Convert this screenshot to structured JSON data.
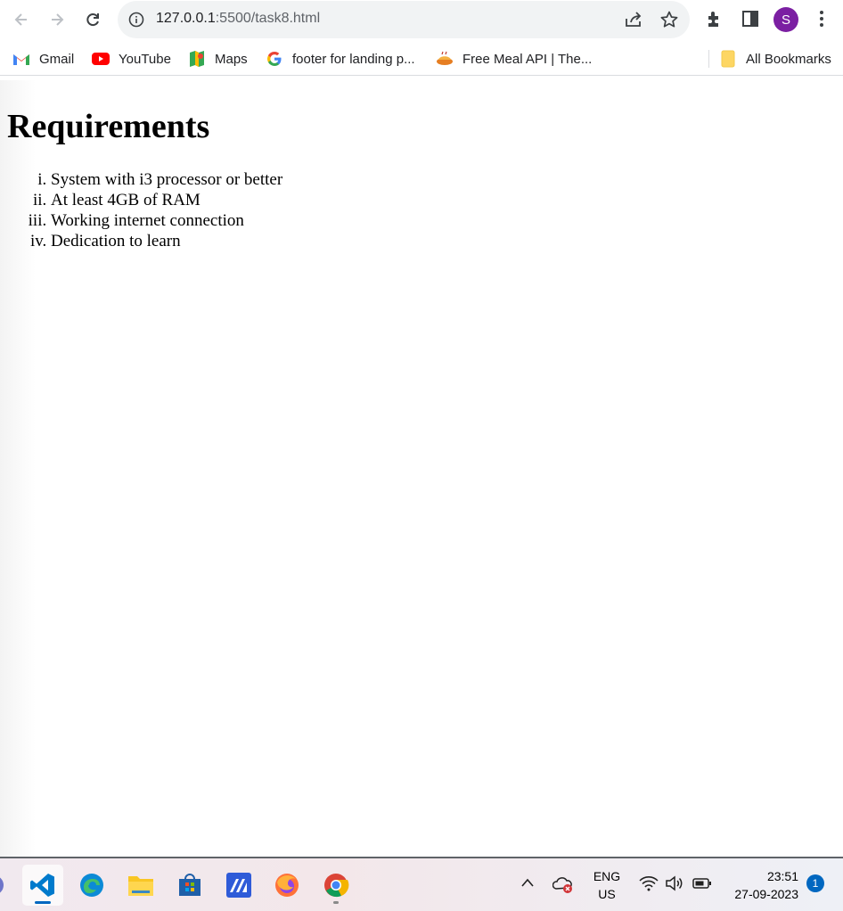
{
  "browser": {
    "url_host": "127.0.0.1",
    "url_path": ":5500/task8.html",
    "avatar_letter": "S",
    "avatar_color": "#7b1fa2"
  },
  "bookmarks": [
    {
      "label": "Gmail",
      "icon": "gmail-icon"
    },
    {
      "label": "YouTube",
      "icon": "youtube-icon"
    },
    {
      "label": "Maps",
      "icon": "maps-icon"
    },
    {
      "label": "footer for landing p...",
      "icon": "google-icon"
    },
    {
      "label": "Free Meal API | The...",
      "icon": "meal-icon"
    }
  ],
  "all_bookmarks_label": "All Bookmarks",
  "page": {
    "title": "Requirements",
    "items": [
      "System with i3 processor or better",
      "At least 4GB of RAM",
      "Working internet connection",
      "Dedication to learn"
    ]
  },
  "taskbar": {
    "apps": [
      "vscode-icon",
      "edge-icon",
      "file-explorer-icon",
      "store-icon",
      "editor-icon",
      "firefox-icon",
      "chrome-icon"
    ],
    "lang_line1": "ENG",
    "lang_line2": "US",
    "time": "23:51",
    "date": "27-09-2023",
    "notification_count": "1"
  }
}
